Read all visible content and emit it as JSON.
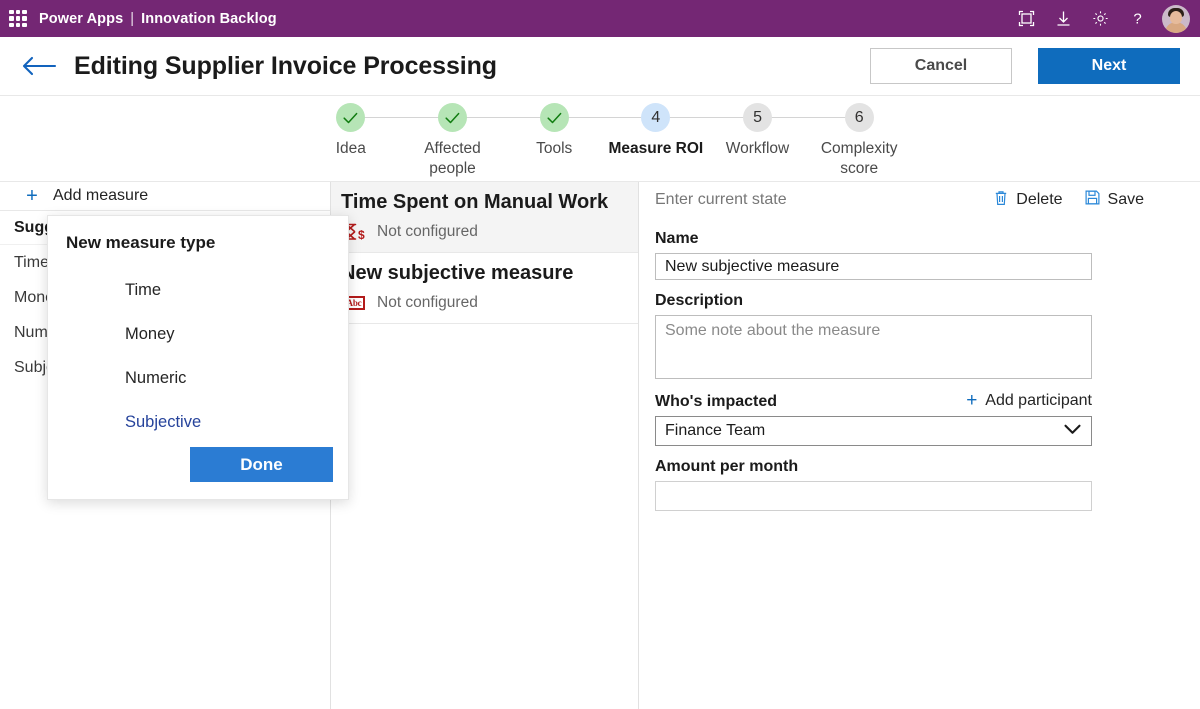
{
  "suite": {
    "waffle_icon": "app-launcher-icon",
    "brand": "Power Apps",
    "separator": "|",
    "app_name": "Innovation Backlog",
    "icons": [
      {
        "name": "fullscreen-icon",
        "label": "Fullscreen"
      },
      {
        "name": "download-icon",
        "label": "Download"
      },
      {
        "name": "gear-icon",
        "label": "Settings"
      },
      {
        "name": "help-icon",
        "label": "Help"
      }
    ],
    "avatar_label": "Account manager"
  },
  "header": {
    "back_icon": "back-arrow-icon",
    "title": "Editing Supplier Invoice Processing",
    "cancel_label": "Cancel",
    "next_label": "Next"
  },
  "stepper": {
    "steps": [
      {
        "number": "1",
        "mark": "✓",
        "label": "Idea",
        "state": "done"
      },
      {
        "number": "2",
        "mark": "✓",
        "label": "Affected people",
        "state": "done"
      },
      {
        "number": "3",
        "mark": "✓",
        "label": "Tools",
        "state": "done"
      },
      {
        "number": "4",
        "mark": "4",
        "label": "Measure ROI",
        "state": "active"
      },
      {
        "number": "5",
        "mark": "5",
        "label": "Workflow",
        "state": "todo"
      },
      {
        "number": "6",
        "mark": "6",
        "label": "Complexity score",
        "state": "todo"
      }
    ]
  },
  "left_panel": {
    "add_measure_label": "Add measure",
    "list_header": "Suggested",
    "items": [
      {
        "label": "Time"
      },
      {
        "label": "Money"
      },
      {
        "label": "Numeric"
      },
      {
        "label": "Subjective"
      }
    ]
  },
  "measure_list": {
    "cards": [
      {
        "title": "Time Spent on Manual Work",
        "status": "Not configured",
        "icon": "hourglass-money-icon",
        "selected": true
      },
      {
        "title": "New subjective measure",
        "status": "Not configured",
        "icon": "abc-text-icon",
        "icon_text": "Abc",
        "selected": false
      }
    ]
  },
  "detail_form": {
    "state_text": "Enter current state",
    "delete_label": "Delete",
    "save_label": "Save",
    "name_label": "Name",
    "name_value": "New subjective measure",
    "description_label": "Description",
    "description_placeholder": "Some note about the measure",
    "description_value": "",
    "impacted_label": "Who's impacted",
    "add_participant_label": "Add participant",
    "impacted_value": "Finance Team",
    "amount_label": "Amount per month",
    "amount_value": ""
  },
  "callout": {
    "title": "New measure type",
    "options": [
      {
        "label": "Time",
        "selected": false
      },
      {
        "label": "Money",
        "selected": false
      },
      {
        "label": "Numeric",
        "selected": false
      },
      {
        "label": "Subjective",
        "selected": true
      }
    ],
    "done_label": "Done"
  },
  "colors": {
    "suite_bar": "#742774",
    "primary_button": "#0f6cbd",
    "done_button": "#2b7cd3",
    "step_done": "#b6e5b6",
    "step_active": "#cfe4fa",
    "step_todo": "#e3e3e3",
    "measure_icon": "#b31b1b",
    "selected_option": "#26439b"
  }
}
